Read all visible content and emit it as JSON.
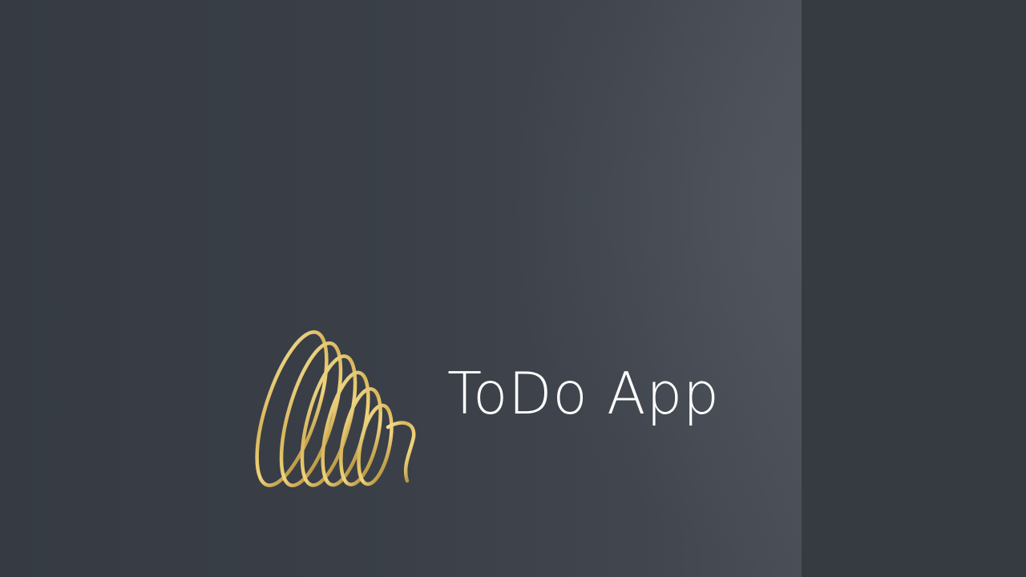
{
  "app": {
    "title": "ToDo App",
    "logo_icon": "gold-scribble-logo-icon"
  },
  "colors": {
    "background": "#353a42",
    "panel_highlight": "#4a4f57",
    "side_panel": "#363a41",
    "title_text": "#ffffff",
    "logo_gold_light": "#f3dc8a",
    "logo_gold_dark": "#9c7626"
  }
}
